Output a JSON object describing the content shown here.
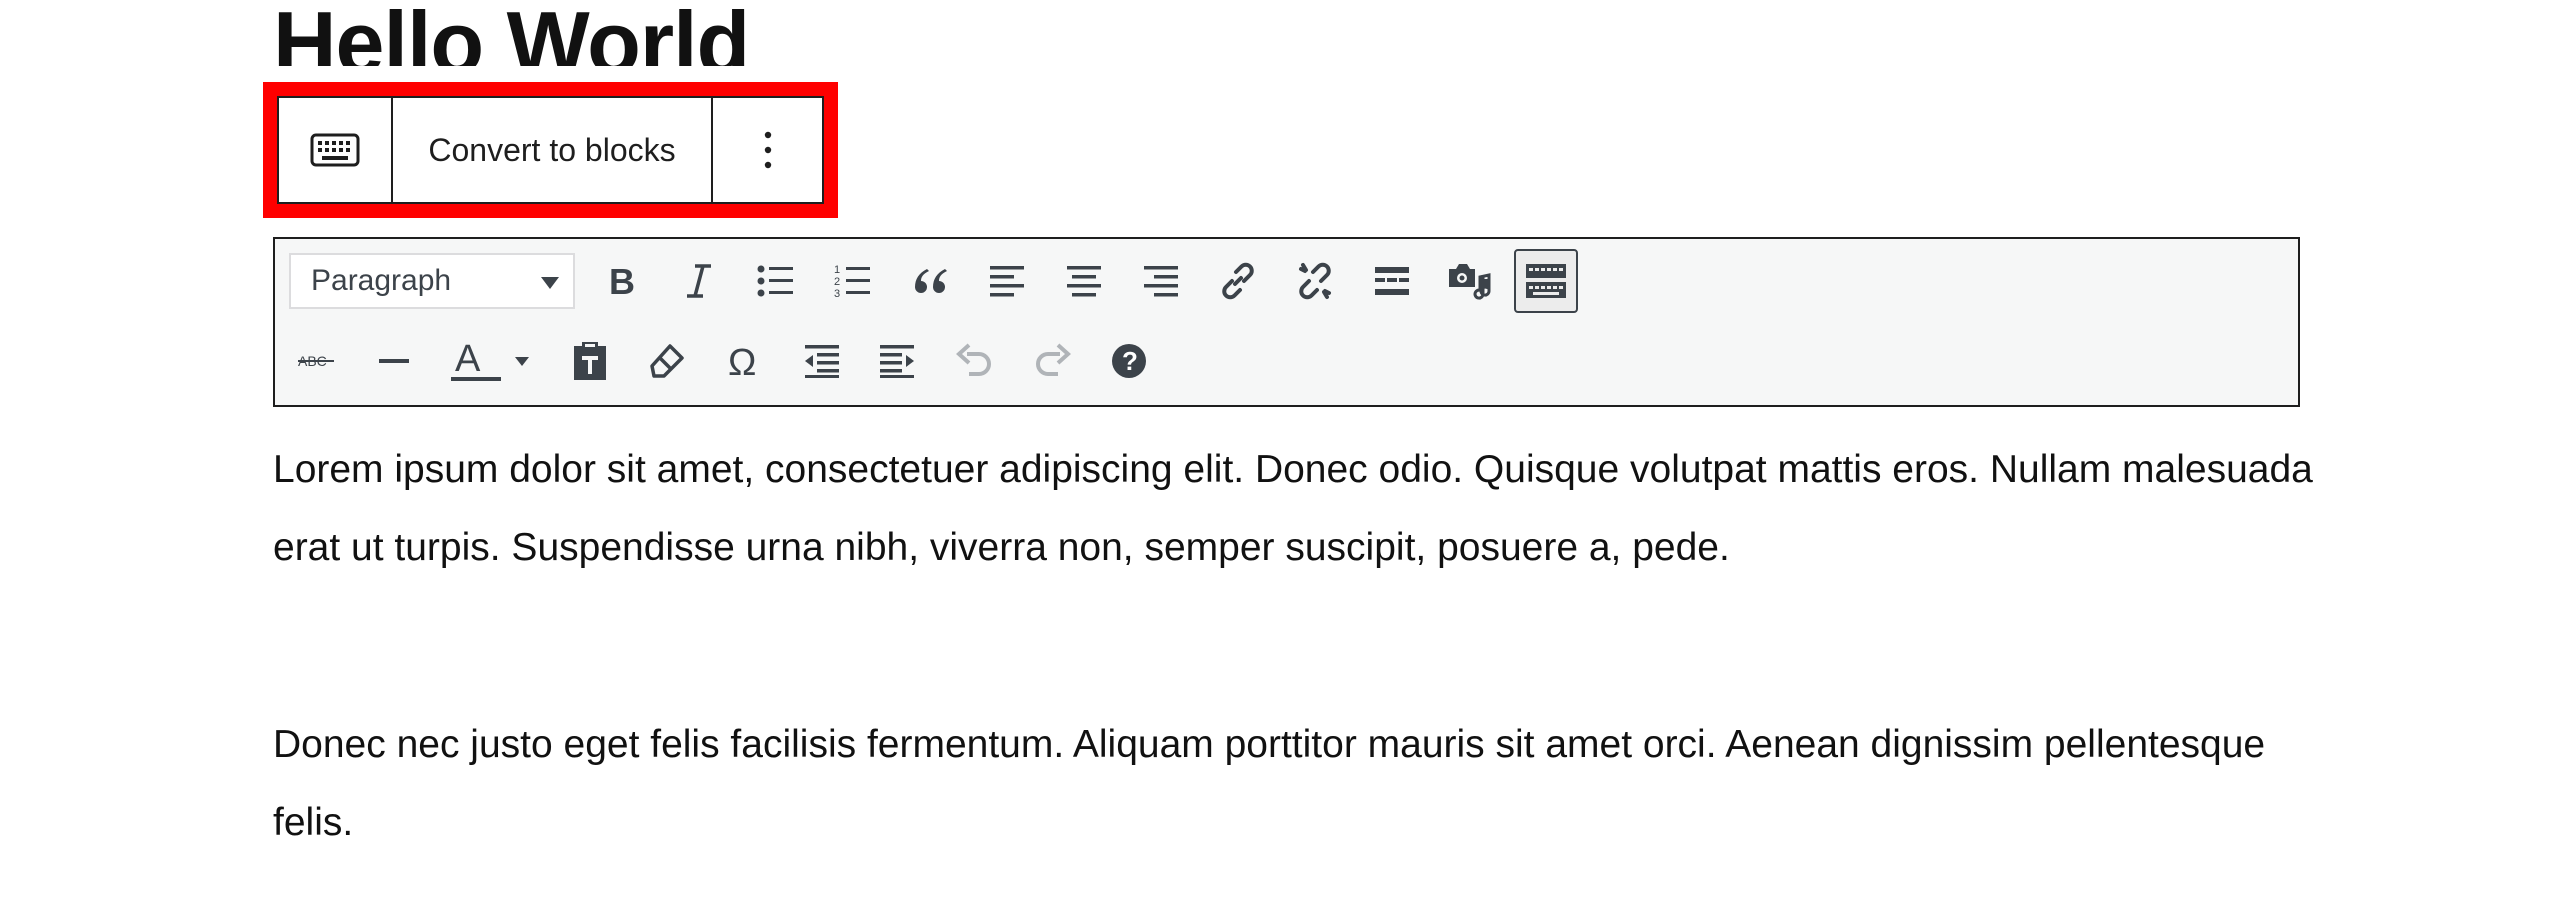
{
  "post": {
    "title": "Hello World"
  },
  "block_toolbar": {
    "edit_as_html_icon": "keyboard-icon",
    "convert_label": "Convert to blocks",
    "more_icon": "more-vertical-icon"
  },
  "classic_toolbar": {
    "format_select": {
      "selected": "Paragraph"
    },
    "row1_icons": [
      "bold-icon",
      "italic-icon",
      "bullet-list-icon",
      "numbered-list-icon",
      "blockquote-icon",
      "align-left-icon",
      "align-center-icon",
      "align-right-icon",
      "link-icon",
      "unlink-icon",
      "read-more-icon",
      "add-media-icon",
      "toolbar-toggle-icon"
    ],
    "row2_icons": [
      "strikethrough-icon",
      "horizontal-line-icon",
      "text-color-icon",
      "paste-as-text-icon",
      "clear-formatting-icon",
      "special-character-icon",
      "outdent-icon",
      "indent-icon",
      "undo-icon",
      "redo-icon",
      "help-icon"
    ]
  },
  "content": {
    "paragraphs": [
      "Lorem ipsum dolor sit amet, consectetuer adipiscing elit. Donec odio. Quisque volutpat mattis eros. Nullam malesuada erat ut turpis. Suspendisse urna nibh, viverra non, semper suscipit, posuere a, pede.",
      "Donec nec justo eget felis facilisis fermentum. Aliquam porttitor mauris sit amet orci. Aenean dignissim pellentesque felis."
    ]
  },
  "colors": {
    "highlight": "#ff0000",
    "toolbar_bg": "#f6f7f7",
    "icon": "#3c434a"
  }
}
